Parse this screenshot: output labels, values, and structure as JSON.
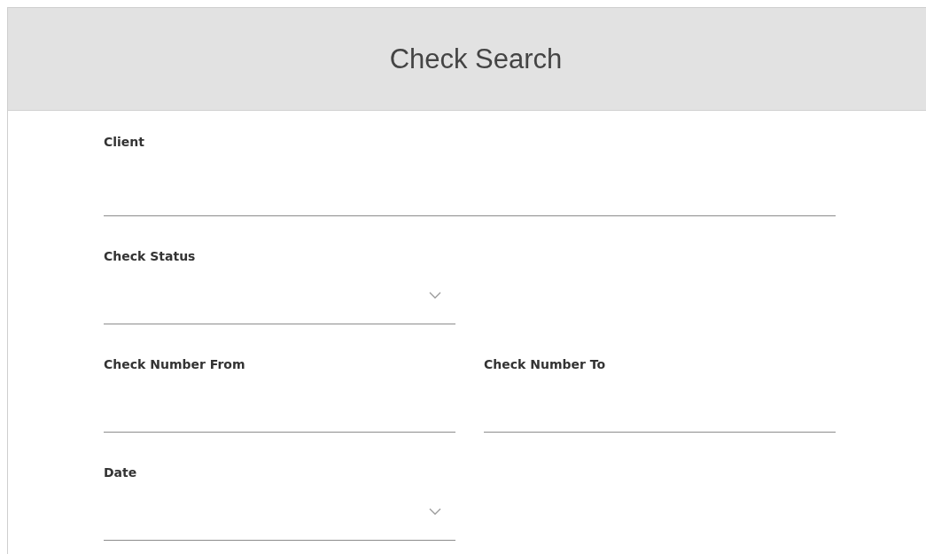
{
  "header": {
    "title": "Check Search"
  },
  "rows": [
    {
      "fields": [
        {
          "label": "Client",
          "kind": "wide"
        }
      ]
    },
    {
      "fields": [
        {
          "label": "Check Status",
          "kind": "select"
        }
      ]
    },
    {
      "fields": [
        {
          "label": "Check Number From",
          "kind": "text"
        },
        {
          "label": "Check Number To",
          "kind": "text"
        }
      ]
    },
    {
      "fields": [
        {
          "label": "Date",
          "kind": "select"
        }
      ]
    }
  ]
}
